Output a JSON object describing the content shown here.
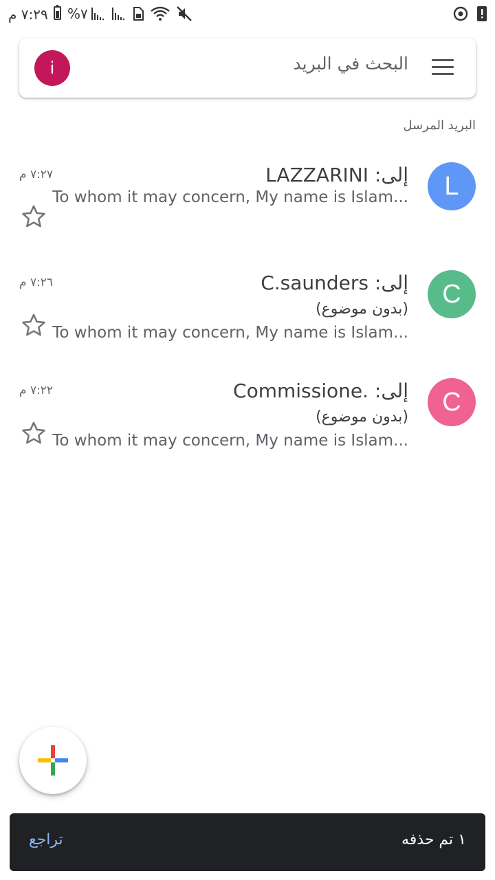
{
  "status_bar": {
    "time": "٧:٢٩ م",
    "battery": "%٧"
  },
  "search": {
    "placeholder": "البحث في البريد",
    "account_initial": "i",
    "account_color": "#c2185b"
  },
  "section_label": "البريد المرسل",
  "emails": [
    {
      "avatar_letter": "L",
      "avatar_color": "#5e97f6",
      "recipient": "إلى: LAZZARINI",
      "subject": "",
      "snippet": "To whom it may concern,   My name is Islam...",
      "time": "٧:٢٧ م",
      "starred": false
    },
    {
      "avatar_letter": "C",
      "avatar_color": "#57bb8a",
      "recipient": "إلى: C.saunders",
      "subject": "(بدون موضوع)",
      "snippet": "To whom it may concern, My name is Islam...",
      "time": "٧:٢٦ م",
      "starred": false
    },
    {
      "avatar_letter": "C",
      "avatar_color": "#f06292",
      "recipient": "إلى: .Commissione",
      "subject": "(بدون موضوع)",
      "snippet": "To whom it may concern, My name is Islam...",
      "time": "٧:٢٢ م",
      "starred": false
    }
  ],
  "compose": {
    "icon": "plus-icon"
  },
  "snackbar": {
    "message": "١ تم حذفه",
    "action": "تراجع"
  }
}
